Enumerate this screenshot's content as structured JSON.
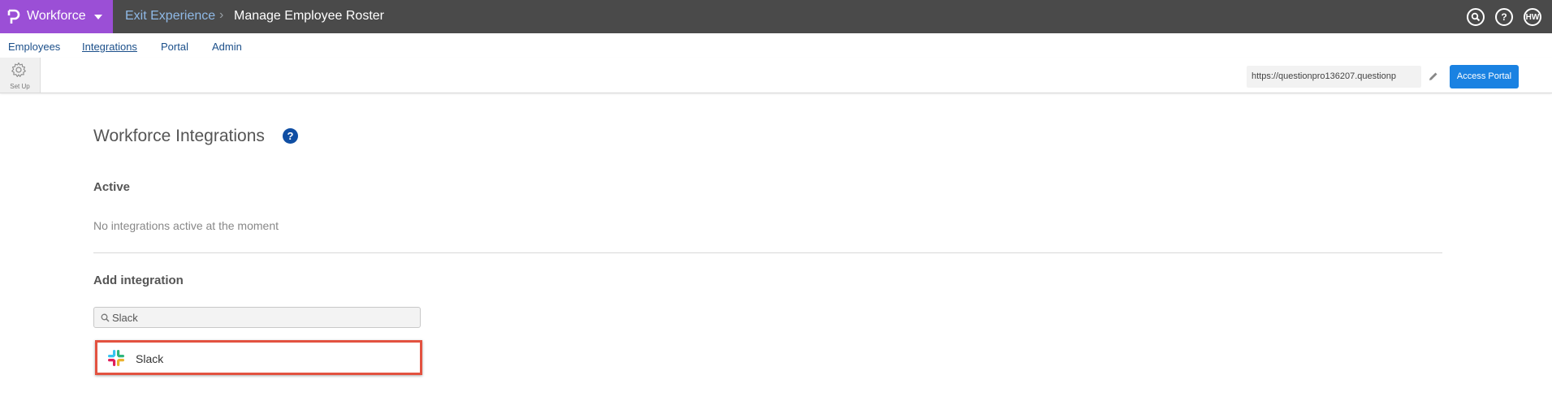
{
  "header": {
    "brand": "Workforce",
    "breadcrumb": [
      "Exit Experience",
      "Manage Employee Roster"
    ],
    "breadcrumb_separator": "›",
    "user_initials": "HW"
  },
  "nav": {
    "tabs": [
      {
        "label": "Employees",
        "active": false
      },
      {
        "label": "Integrations",
        "active": true
      },
      {
        "label": "Portal",
        "active": false
      },
      {
        "label": "Admin",
        "active": false
      }
    ]
  },
  "toolbar": {
    "setup_label": "Set Up",
    "portal_url": "https://questionpro136207.questionp",
    "access_button": "Access Portal"
  },
  "main": {
    "title": "Workforce Integrations",
    "active_heading": "Active",
    "empty_message": "No integrations active at the moment",
    "add_heading": "Add integration",
    "search_value": "Slack",
    "results": [
      {
        "label": "Slack",
        "icon": "slack-icon"
      }
    ]
  },
  "colors": {
    "brand": "#9b4fd6",
    "topbar": "#4a4a4a",
    "accent": "#1a82e2",
    "highlight": "#e35240"
  }
}
